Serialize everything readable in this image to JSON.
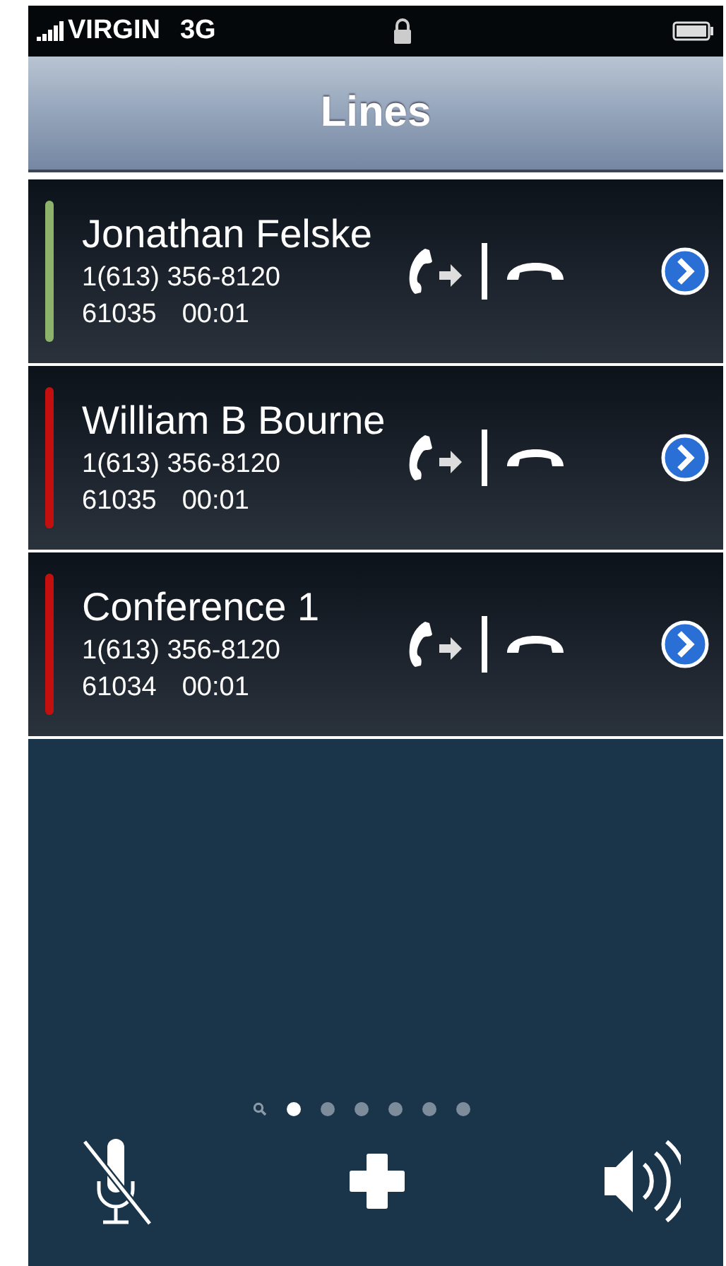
{
  "status_bar": {
    "carrier": "VIRGIN",
    "network": "3G"
  },
  "nav_bar": {
    "title": "Lines"
  },
  "lines": [
    {
      "name": "Jonathan Felske",
      "number": "1(613) 356-8120",
      "extension": "61035",
      "duration": "00:01",
      "color": "#8db26a"
    },
    {
      "name": "William B Bourne",
      "number": "1(613) 356-8120",
      "extension": "61035",
      "duration": "00:01",
      "color": "#c40f0f"
    },
    {
      "name": "Conference 1",
      "number": "1(613) 356-8120",
      "extension": "61034",
      "duration": "00:01",
      "color": "#c40f0f"
    }
  ],
  "page_dots": [
    {
      "selected": true
    },
    {
      "selected": false
    },
    {
      "selected": false
    },
    {
      "selected": false
    },
    {
      "selected": false
    },
    {
      "selected": false
    }
  ]
}
